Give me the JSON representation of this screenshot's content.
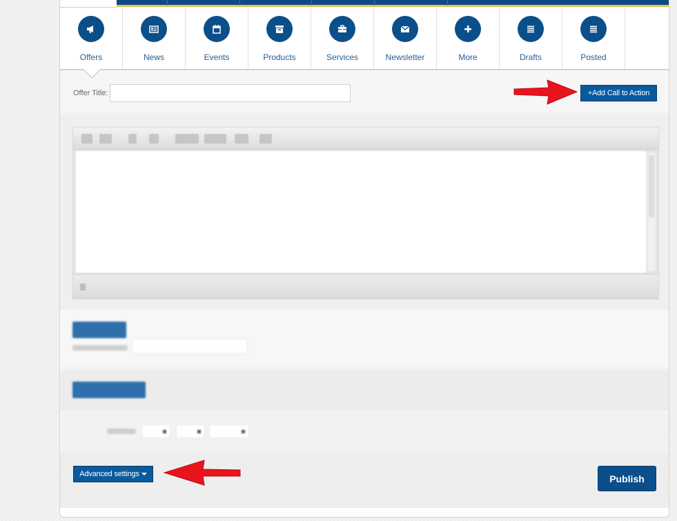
{
  "nav": {
    "tabs": [
      {
        "label": "Offers",
        "icon": "megaphone-icon"
      },
      {
        "label": "News",
        "icon": "newspaper-icon"
      },
      {
        "label": "Events",
        "icon": "calendar-icon"
      },
      {
        "label": "Products",
        "icon": "archive-box-icon"
      },
      {
        "label": "Services",
        "icon": "briefcase-icon"
      },
      {
        "label": "Newsletter",
        "icon": "envelope-icon"
      },
      {
        "label": "More",
        "icon": "plus-icon"
      },
      {
        "label": "Drafts",
        "icon": "list-icon"
      },
      {
        "label": "Posted",
        "icon": "list-icon"
      }
    ],
    "active_tab": "Offers"
  },
  "offer_form": {
    "title_label": "Offer Title:",
    "title_value": "",
    "cta_button": "+Add Call to Action"
  },
  "footer": {
    "advanced_settings": "Advanced settings",
    "publish": "Publish"
  },
  "colors": {
    "brand_blue": "#0b4f8a",
    "accent_yellow": "#e3c44a",
    "annotation_red": "#e8141b"
  }
}
